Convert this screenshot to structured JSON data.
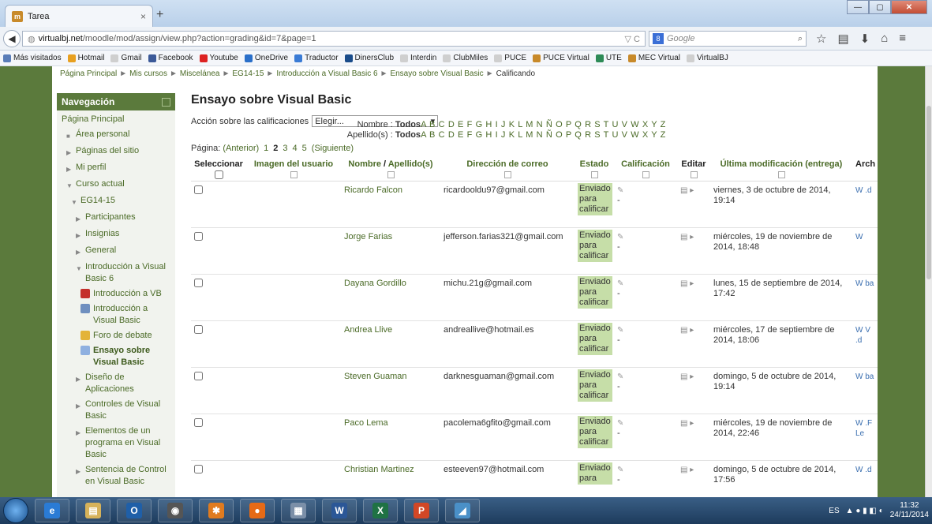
{
  "browser": {
    "tab_title": "Tarea",
    "tab_close": "×",
    "new_tab": "+",
    "url_host": "virtualbj.net",
    "url_path": "/moodle/mod/assign/view.php?action=grading&id=7&page=1",
    "url_icons": "▽ C",
    "search_engine": "8",
    "search_placeholder": "Google",
    "win_min": "—",
    "win_max": "▢",
    "win_close": "✕"
  },
  "bookmarks": [
    {
      "label": "Más visitados",
      "color": "#5a7db8"
    },
    {
      "label": "Hotmail",
      "color": "#e8a020"
    },
    {
      "label": "Gmail",
      "color": "#cfcfcf"
    },
    {
      "label": "Facebook",
      "color": "#3b5998"
    },
    {
      "label": "Youtube",
      "color": "#d22"
    },
    {
      "label": "OneDrive",
      "color": "#2a6fc9"
    },
    {
      "label": "Traductor",
      "color": "#3a7bd5"
    },
    {
      "label": "DinersClub",
      "color": "#1a4c8a"
    },
    {
      "label": "Interdin",
      "color": "#cfcfcf"
    },
    {
      "label": "ClubMiles",
      "color": "#cfcfcf"
    },
    {
      "label": "PUCE",
      "color": "#cfcfcf"
    },
    {
      "label": "PUCE Virtual",
      "color": "#c88a2a"
    },
    {
      "label": "UTE",
      "color": "#2e8b57"
    },
    {
      "label": "MEC Virtual",
      "color": "#c88a2a"
    },
    {
      "label": "VirtualBJ",
      "color": "#cfcfcf"
    }
  ],
  "breadcrumb": {
    "items": [
      "Página Principal",
      "Mis cursos",
      "Miscelánea",
      "EG14-15",
      "Introducción a Visual Basic 6",
      "Ensayo sobre Visual Basic"
    ],
    "current": "Calificando",
    "sep": "►"
  },
  "nav": {
    "title": "Navegación",
    "items": [
      {
        "label": "Página Principal",
        "arrow": ""
      },
      {
        "label": "Área personal",
        "arrow": "■"
      },
      {
        "label": "Páginas del sitio",
        "arrow": "▶"
      },
      {
        "label": "Mi perfil",
        "arrow": "▶"
      },
      {
        "label": "Curso actual",
        "arrow": "▼"
      },
      {
        "label": "EG14-15",
        "arrow": "▼"
      },
      {
        "label": "Participantes",
        "arrow": "▶"
      },
      {
        "label": "Insignias",
        "arrow": "▶"
      },
      {
        "label": "General",
        "arrow": "▶"
      },
      {
        "label": "Introducción a Visual Basic 6",
        "arrow": "▼"
      },
      {
        "label": "Introducción a VB",
        "icon": "#c4302b"
      },
      {
        "label": "Introducción a Visual Basic",
        "icon": "#6f8fbf"
      },
      {
        "label": "Foro de debate",
        "icon": "#e3b339"
      },
      {
        "label": "Ensayo sobre Visual Basic",
        "icon": "#8fb0e0",
        "bold": true
      },
      {
        "label": "Diseño de Aplicaciones",
        "arrow": "▶"
      },
      {
        "label": "Controles de Visual Basic",
        "arrow": "▶"
      },
      {
        "label": "Elementos de un programa en Visual Basic",
        "arrow": "▶"
      },
      {
        "label": "Sentencia de Control en Visual Basic",
        "arrow": "▶"
      }
    ]
  },
  "main": {
    "title": "Ensayo sobre Visual Basic",
    "action_label": "Acción sobre las calificaciones",
    "action_value": "Elegir...",
    "filter_first_label": "Nombre :",
    "filter_last_label": "Apellido(s) :",
    "filter_all": "Todos",
    "filter_letters": "A B C D E F G H I J K L M N Ñ O P Q R S T U V W X Y Z",
    "pager_label": "Página:",
    "pager_prev": "(Anterior)",
    "pager_pages": [
      "1",
      "2",
      "3",
      "4",
      "5"
    ],
    "pager_current": "2",
    "pager_next": "(Siguiente)"
  },
  "table": {
    "headers": {
      "select": "Seleccionar",
      "image": "Imagen del usuario",
      "name_first": "Nombre",
      "name_sep": " / ",
      "name_last": "Apellido(s)",
      "email": "Dirección de correo",
      "status": "Estado",
      "grade": "Calificación",
      "edit": "Editar",
      "modified": "Última modificación (entrega)",
      "files": "Arch"
    },
    "rows": [
      {
        "name": "Ricardo Falcon",
        "email": "ricardooldu97@gmail.com",
        "status": "Enviado para calificar",
        "grade": "-",
        "modified": "viernes, 3 de octubre de 2014, 19:14",
        "file": "W .d"
      },
      {
        "name": "Jorge Farias",
        "email": "jefferson.farias321@gmail.com",
        "status": "Enviado para calificar",
        "grade": "-",
        "modified": "miércoles, 19 de noviembre de 2014, 18:48",
        "file": "W"
      },
      {
        "name": "Dayana Gordillo",
        "email": "michu.21g@gmail.com",
        "status": "Enviado para calificar",
        "grade": "-",
        "modified": "lunes, 15 de septiembre de 2014, 17:42",
        "file": "W ba"
      },
      {
        "name": "Andrea Llive",
        "email": "andreallive@hotmail.es",
        "status": "Enviado para calificar",
        "grade": "-",
        "modified": "miércoles, 17 de septiembre de 2014, 18:06",
        "file": "W V .d"
      },
      {
        "name": "Steven Guaman",
        "email": "darknesguaman@gmail.com",
        "status": "Enviado para calificar",
        "grade": "-",
        "modified": "domingo, 5 de octubre de 2014, 19:14",
        "file": "W ba"
      },
      {
        "name": "Paco Lema",
        "email": "pacolema6gfito@gmail.com",
        "status": "Enviado para calificar",
        "grade": "-",
        "modified": "miércoles, 19 de noviembre de 2014, 22:46",
        "file": "W .F Le"
      },
      {
        "name": "Christian Martinez",
        "email": "esteeven97@hotmail.com",
        "status": "Enviado para",
        "grade": "-",
        "modified": "domingo, 5 de octubre de 2014, 17:56",
        "file": "W .d"
      }
    ]
  },
  "taskbar": {
    "apps": [
      {
        "name": "ie",
        "glyph": "e",
        "color": "#2a7bd5"
      },
      {
        "name": "explorer",
        "glyph": "▤",
        "color": "#d6b25a"
      },
      {
        "name": "outlook",
        "glyph": "O",
        "color": "#1f5fa8"
      },
      {
        "name": "app4",
        "glyph": "◉",
        "color": "#555"
      },
      {
        "name": "app5",
        "glyph": "✱",
        "color": "#e07b1f"
      },
      {
        "name": "firefox",
        "glyph": "●",
        "color": "#e66a16"
      },
      {
        "name": "calc",
        "glyph": "▦",
        "color": "#7b8fa8"
      },
      {
        "name": "word",
        "glyph": "W",
        "color": "#2b5797"
      },
      {
        "name": "excel",
        "glyph": "X",
        "color": "#1f7244"
      },
      {
        "name": "powerpoint",
        "glyph": "P",
        "color": "#d24726"
      },
      {
        "name": "app11",
        "glyph": "◢",
        "color": "#4a90c8"
      }
    ],
    "lang": "ES",
    "time": "11:32",
    "date": "24/11/2014"
  }
}
